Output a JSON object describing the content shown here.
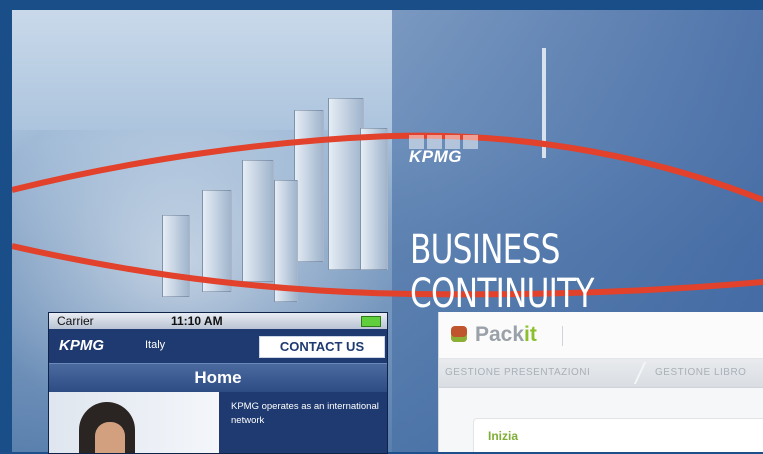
{
  "hero": {
    "logo": "KPMG",
    "title_line1": "BUSINESS",
    "title_line2": "CONTINUITY"
  },
  "phone": {
    "status": {
      "carrier": "Carrier",
      "time": "11:10 AM"
    },
    "logo": "KPMG",
    "country": "Italy",
    "contact_label": "CONTACT US",
    "page_title": "Home",
    "body_text": "KPMG operates as an international network"
  },
  "packit": {
    "brand_plain": "Pack",
    "brand_accent": "it",
    "tabs": [
      "GESTIONE PRESENTAZIONI",
      "GESTIONE LIBRO"
    ],
    "card_title": "Inizia"
  },
  "colors": {
    "frame": "#1a4e88",
    "red_line": "#e2412b",
    "phone_nav": "#1e3a70",
    "packit_green": "#8cbf2e"
  }
}
